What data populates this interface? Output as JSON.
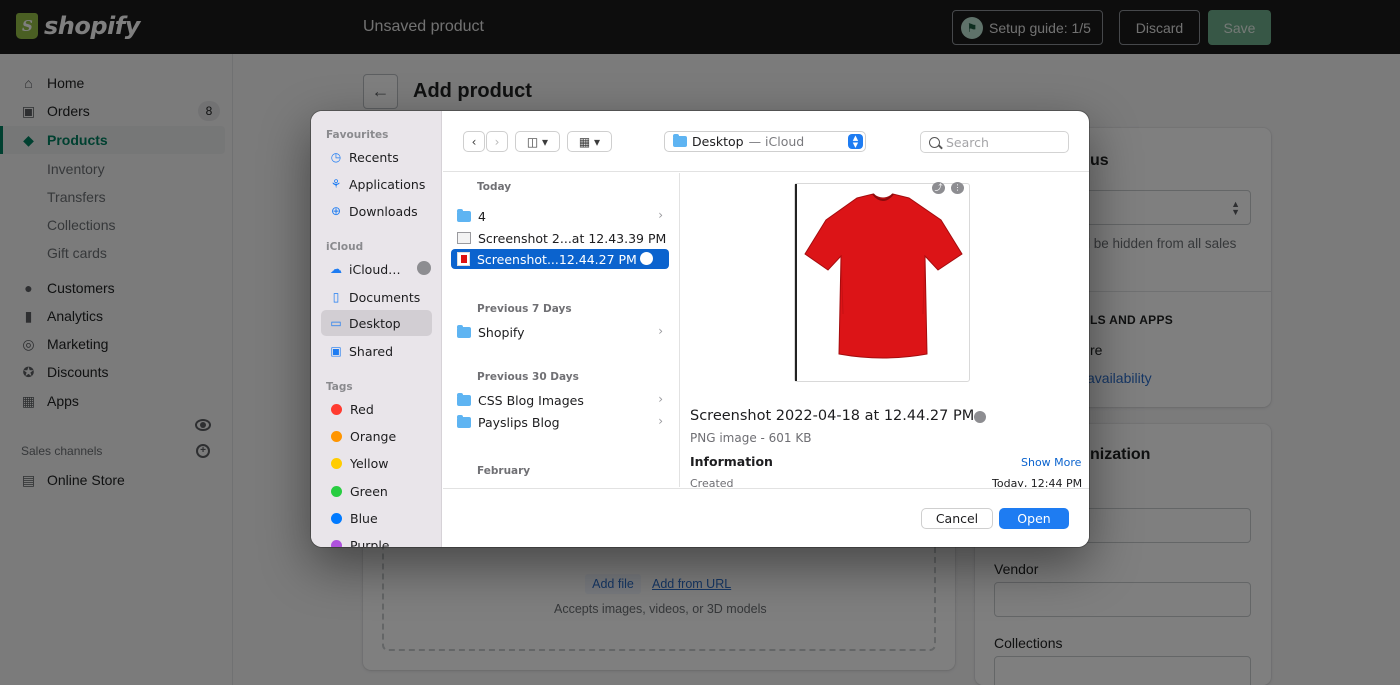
{
  "topbar": {
    "brand": "shopify",
    "title": "Unsaved product",
    "setup_guide": "Setup guide: 1/5",
    "discard": "Discard",
    "save": "Save"
  },
  "sidebar": {
    "items": [
      {
        "label": "Home",
        "icon": "home-icon"
      },
      {
        "label": "Orders",
        "icon": "orders-icon",
        "badge": "8"
      },
      {
        "label": "Products",
        "icon": "tag-icon",
        "active": true
      },
      {
        "label": "Customers",
        "icon": "person-icon"
      },
      {
        "label": "Analytics",
        "icon": "bar-chart-icon"
      },
      {
        "label": "Marketing",
        "icon": "target-icon"
      },
      {
        "label": "Discounts",
        "icon": "discount-icon"
      },
      {
        "label": "Apps",
        "icon": "apps-icon"
      }
    ],
    "subitems": [
      "Inventory",
      "Transfers",
      "Collections",
      "Gift cards"
    ],
    "sales_channels": "Sales channels",
    "online_store": "Online Store"
  },
  "page": {
    "title": "Add product",
    "add_file": "Add file",
    "add_from_url": "Add from URL",
    "accepts": "Accepts images, videos, or 3D models",
    "status_title": "us",
    "hidden_note": "ll be hidden from all sales",
    "sales_apps": "LS AND APPS",
    "store_text": "re",
    "availability": "availability",
    "org_title": "nization",
    "vendor": "Vendor",
    "collections": "Collections"
  },
  "dialog": {
    "sidebar": {
      "favourites_head": "Favourites",
      "favourites": [
        "Recents",
        "Applications",
        "Downloads"
      ],
      "icloud_head": "iCloud",
      "icloud": [
        "iCloud…",
        "Documents",
        "Desktop",
        "Shared"
      ],
      "tags_head": "Tags",
      "tags": [
        {
          "label": "Red",
          "color": "#ff3b30"
        },
        {
          "label": "Orange",
          "color": "#ff9500"
        },
        {
          "label": "Yellow",
          "color": "#ffcc00"
        },
        {
          "label": "Green",
          "color": "#28cd41"
        },
        {
          "label": "Blue",
          "color": "#007aff"
        },
        {
          "label": "Purple",
          "color": "#af52de"
        }
      ]
    },
    "location": {
      "name": "Desktop",
      "sub": "— iCloud"
    },
    "search_placeholder": "Search",
    "groups": {
      "today": "Today",
      "prev7": "Previous 7 Days",
      "prev30": "Previous 30 Days",
      "february": "February"
    },
    "files": {
      "f4": "4",
      "shot1": "Screenshot 2...at 12.43.39 PM",
      "shot2": "Screenshot...12.44.27 PM",
      "shopify": "Shopify",
      "css": "CSS Blog Images",
      "payslips": "Payslips Blog"
    },
    "preview": {
      "name": "Screenshot 2022-04-18 at 12.44.27 PM",
      "meta": "PNG image - 601 KB",
      "info": "Information",
      "show_more": "Show More",
      "created_label": "Created",
      "created_value": "Today, 12:44 PM"
    },
    "cancel": "Cancel",
    "open": "Open"
  }
}
